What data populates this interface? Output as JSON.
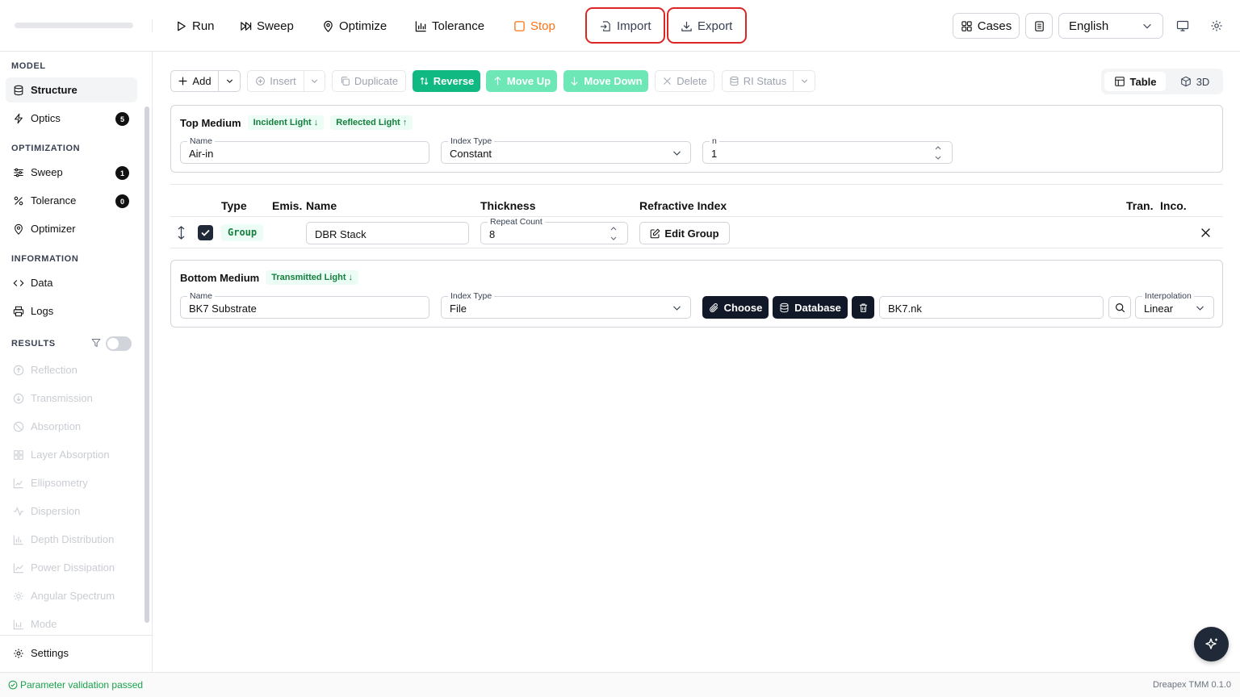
{
  "toolbar": {
    "run": "Run",
    "sweep": "Sweep",
    "optimize": "Optimize",
    "tolerance": "Tolerance",
    "stop": "Stop",
    "import": "Import",
    "export": "Export",
    "cases": "Cases",
    "language": "English"
  },
  "sidebar": {
    "model_title": "MODEL",
    "structure": "Structure",
    "optics": "Optics",
    "optics_count": "5",
    "optimization_title": "OPTIMIZATION",
    "sweep": "Sweep",
    "sweep_count": "1",
    "tolerance": "Tolerance",
    "tolerance_count": "0",
    "optimizer": "Optimizer",
    "information_title": "INFORMATION",
    "data": "Data",
    "logs": "Logs",
    "results_title": "RESULTS",
    "results": [
      "Reflection",
      "Transmission",
      "Absorption",
      "Layer Absorption",
      "Ellipsometry",
      "Dispersion",
      "Depth Distribution",
      "Power Dissipation",
      "Angular Spectrum",
      "Mode"
    ],
    "settings": "Settings"
  },
  "actions": {
    "add": "Add",
    "insert": "Insert",
    "duplicate": "Duplicate",
    "reverse": "Reverse",
    "move_up": "Move Up",
    "move_down": "Move Down",
    "delete": "Delete",
    "ri_status": "RI Status",
    "view_table": "Table",
    "view_3d": "3D"
  },
  "top_medium": {
    "title": "Top Medium",
    "tag_incident": "Incident Light ↓",
    "tag_reflected": "Reflected Light ↑",
    "name_label": "Name",
    "name_value": "Air-in",
    "index_type_label": "Index Type",
    "index_type_value": "Constant",
    "n_label": "n",
    "n_value": "1"
  },
  "table": {
    "headers": {
      "type": "Type",
      "emis": "Emis.",
      "name": "Name",
      "thickness": "Thickness",
      "refractive_index": "Refractive Index",
      "tran": "Tran.",
      "inco": "Inco."
    },
    "row": {
      "type": "Group",
      "name": "DBR Stack",
      "repeat_label": "Repeat Count",
      "repeat_value": "8",
      "edit_group": "Edit Group"
    }
  },
  "bottom_medium": {
    "title": "Bottom Medium",
    "tag_transmitted": "Transmitted Light ↓",
    "name_label": "Name",
    "name_value": "BK7 Substrate",
    "index_type_label": "Index Type",
    "index_type_value": "File",
    "choose": "Choose",
    "database": "Database",
    "file_value": "BK7.nk",
    "interp_label": "Interpolation",
    "interp_value": "Linear"
  },
  "status": {
    "message": "Parameter validation passed",
    "version": "Dreapex TMM 0.1.0"
  },
  "colors": {
    "green": "#10b981",
    "highlight": "#dc2626",
    "stop": "#f97316"
  }
}
